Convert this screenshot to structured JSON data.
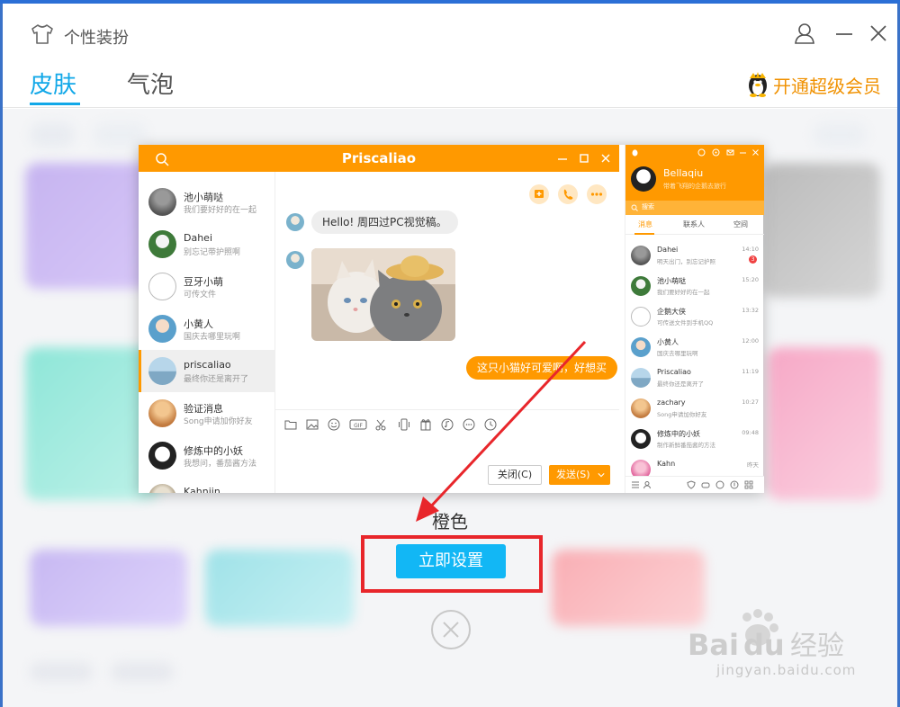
{
  "window": {
    "title": "个性装扮",
    "icons": [
      "tshirt-icon",
      "user-icon",
      "minimize-icon",
      "close-icon"
    ]
  },
  "tabs": [
    {
      "label": "皮肤",
      "active": true
    },
    {
      "label": "气泡",
      "active": false
    }
  ],
  "vip": {
    "label": "开通超级会员",
    "icon": "qq-penguin-icon"
  },
  "preview": {
    "chat": {
      "title": "Priscaliao",
      "contacts": [
        {
          "name": "池小萌哒",
          "sub": "我们要好好的在一起"
        },
        {
          "name": "Dahei",
          "sub": "别忘记带护照啊"
        },
        {
          "name": "豆牙小萌",
          "sub": "可传文件"
        },
        {
          "name": "小黄人",
          "sub": "国庆去哪里玩啊"
        },
        {
          "name": "priscaliao",
          "sub": "最终你还是离开了",
          "selected": true
        },
        {
          "name": "验证消息",
          "sub": "Song申请加你好友"
        },
        {
          "name": "修炼中的小妖",
          "sub": "我想问，番茄酱方法"
        },
        {
          "name": "Kahnjin",
          "sub": ""
        }
      ],
      "messages": [
        {
          "dir": "in",
          "text": "Hello! 周四过PC视觉稿。"
        },
        {
          "dir": "in",
          "type": "image",
          "icon": "cat-photo"
        },
        {
          "dir": "out",
          "text": "这只小猫好可爱啊，好想买"
        }
      ],
      "buttons": {
        "close": "关闭(C)",
        "send": "发送(S)"
      }
    },
    "panel": {
      "name": "Bellaqiu",
      "signature": "带着飞翔的企鹅去旅行",
      "search_placeholder": "搜索",
      "tabs": [
        "消息",
        "联系人",
        "空间"
      ],
      "list": [
        {
          "name": "Dahei",
          "sub": "明天出门，别忘记护照",
          "time": "14:10",
          "badge": "3"
        },
        {
          "name": "池小萌哒",
          "sub": "我们要好好的在一起",
          "time": "15:20"
        },
        {
          "name": "企鹅大侠",
          "sub": "可传送文件到手机QQ",
          "time": "13:32"
        },
        {
          "name": "小黄人",
          "sub": "国庆去哪里玩啊",
          "time": "12:00"
        },
        {
          "name": "Priscaliao",
          "sub": "最终你还是离开了",
          "time": "11:19"
        },
        {
          "name": "zachary",
          "sub": "Song申请加你好友",
          "time": "10:27"
        },
        {
          "name": "修炼中的小妖",
          "sub": "制作新鲜番茄酱的方法",
          "time": "09:48"
        },
        {
          "name": "Kahn",
          "sub": "",
          "time": "昨天"
        }
      ]
    }
  },
  "skin": {
    "name": "橙色",
    "apply_label": "立即设置"
  },
  "watermark": {
    "text": "jingyan.baidu.com"
  },
  "colors": {
    "accent": "#12a8e8",
    "orange": "#ff9900",
    "highlight": "#e8262b",
    "button": "#12b7f5"
  }
}
